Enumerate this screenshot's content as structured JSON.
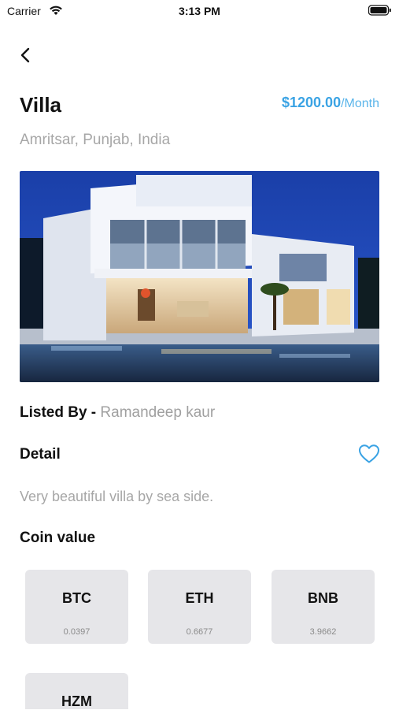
{
  "status_bar": {
    "carrier": "Carrier",
    "time": "3:13 PM"
  },
  "property": {
    "title": "Villa",
    "price": "$1200.00",
    "price_unit": "/Month",
    "location": "Amritsar, Punjab, India",
    "listed_by_label": "Listed By -",
    "listed_by_name": "Ramandeep kaur",
    "detail_heading": "Detail",
    "detail_text": "Very beautiful villa by sea side."
  },
  "coins": {
    "heading": "Coin value",
    "items": [
      {
        "symbol": "BTC",
        "value": "0.0397"
      },
      {
        "symbol": "ETH",
        "value": "0.6677"
      },
      {
        "symbol": "BNB",
        "value": "3.9662"
      },
      {
        "symbol": "HZM",
        "value": ""
      }
    ]
  },
  "colors": {
    "accent": "#3aa3e4",
    "muted": "#a7a7a7",
    "card": "#e6e6e9"
  },
  "icons": {
    "back": "chevron-left-icon",
    "favorite": "heart-outline-icon",
    "wifi": "wifi-icon",
    "battery": "battery-icon"
  }
}
